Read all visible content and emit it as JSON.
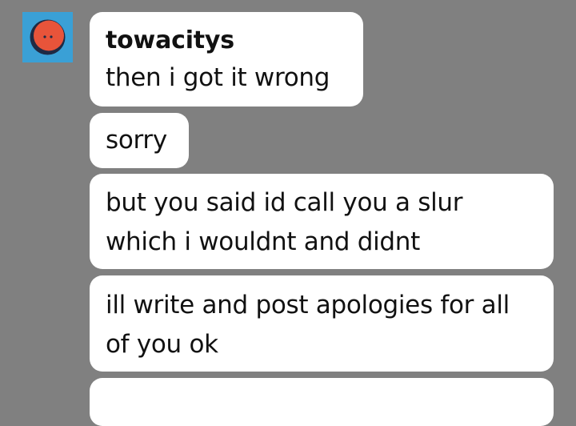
{
  "conversation": {
    "sender": {
      "username": "towacitys",
      "avatar_icon": "orange-face-avatar-icon",
      "avatar_bg_color": "#3aa0d6",
      "avatar_face_color": "#e8543a"
    },
    "messages": [
      {
        "lines": [
          "then i got it wrong"
        ]
      },
      {
        "lines": [
          "sorry"
        ]
      },
      {
        "lines": [
          "but you said id call you a slur",
          "which i wouldnt and didnt"
        ]
      },
      {
        "lines": [
          "ill write and post apologies for all",
          "of you ok"
        ]
      },
      {
        "lines": []
      }
    ]
  }
}
